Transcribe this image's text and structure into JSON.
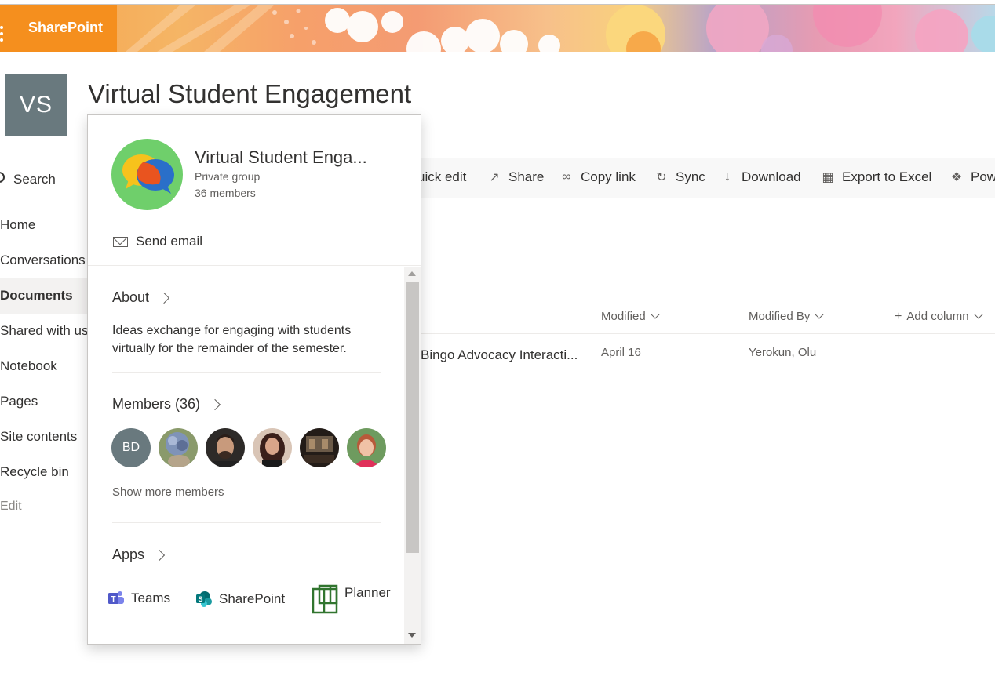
{
  "suite": {
    "brand": "SharePoint"
  },
  "site": {
    "logo_initials": "VS",
    "title": "Virtual Student Engagement"
  },
  "nav": {
    "search_label": "Search",
    "items": [
      {
        "label": "Home"
      },
      {
        "label": "Conversations"
      },
      {
        "label": "Documents",
        "active": true
      },
      {
        "label": "Shared with us"
      },
      {
        "label": "Notebook"
      },
      {
        "label": "Pages"
      },
      {
        "label": "Site contents"
      },
      {
        "label": "Recycle bin"
      }
    ],
    "edit_label": "Edit"
  },
  "commandbar": {
    "quick_edit": "uick edit",
    "share": "Share",
    "copy_link": "Copy link",
    "sync": "Sync",
    "download": "Download",
    "export": "Export to Excel",
    "power": "Pow"
  },
  "list": {
    "columns": {
      "modified": "Modified",
      "modified_by": "Modified By",
      "add_column": "Add column"
    },
    "rows": [
      {
        "name": "Bingo Advocacy Interacti...",
        "modified": "April 16",
        "modified_by": "Yerokun, Olu"
      }
    ]
  },
  "group_card": {
    "name": "Virtual Student Enga...",
    "type": "Private group",
    "member_count": "36 members",
    "send_email": "Send email",
    "about_title": "About",
    "about_text": "Ideas exchange for engaging with students virtually for the remainder of the semester.",
    "members_title": "Members (36)",
    "members": [
      {
        "initials": "BD",
        "color": "#69797e"
      },
      {
        "initials": "",
        "color": "#6b7f9c"
      },
      {
        "initials": "",
        "color": "#3c3330"
      },
      {
        "initials": "",
        "color": "#4a2e2a"
      },
      {
        "initials": "",
        "color": "#2b2320"
      },
      {
        "initials": "",
        "color": "#c8567a"
      }
    ],
    "show_more": "Show more members",
    "apps_title": "Apps",
    "apps": [
      {
        "label": "Teams",
        "icon": "teams-icon",
        "color": "#5059c9"
      },
      {
        "label": "SharePoint",
        "icon": "sharepoint-icon",
        "color": "#038387"
      },
      {
        "label": "Planner",
        "icon": "planner-icon",
        "color": "#31752f"
      }
    ]
  },
  "colors": {
    "brand_orange": "#f58f1e",
    "site_logo": "#69797e",
    "group_avatar": "#6fcf6b"
  }
}
